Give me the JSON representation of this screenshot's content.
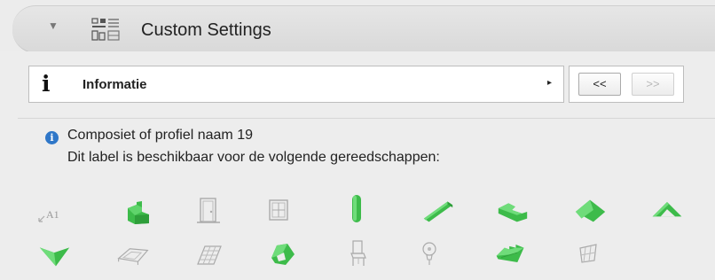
{
  "header": {
    "title": "Custom Settings",
    "icon": "custom-settings-icon",
    "disclosure": "▼"
  },
  "info_bar": {
    "icon_glyph": "i",
    "label": "Informatie",
    "arrow": "▸"
  },
  "nav": {
    "prev_label": "<<",
    "next_label": ">>"
  },
  "description": {
    "line1": "Composiet of profiel naam 19",
    "line2": "Dit label is beschikbaar voor de volgende gereedschappen:"
  },
  "tools": {
    "row1": [
      {
        "name": "label-tool",
        "text": "A1",
        "enabled": false
      },
      {
        "name": "wall-tool",
        "enabled": true
      },
      {
        "name": "door-tool",
        "enabled": false
      },
      {
        "name": "window-tool",
        "enabled": false
      },
      {
        "name": "column-tool",
        "enabled": true
      },
      {
        "name": "beam-tool",
        "enabled": true
      },
      {
        "name": "slab-tool",
        "enabled": true
      },
      {
        "name": "roof-tool",
        "enabled": true
      },
      {
        "name": "shell-tool",
        "enabled": true
      }
    ],
    "row2": [
      {
        "name": "skylight-tool",
        "enabled": true
      },
      {
        "name": "mesh-tool",
        "enabled": false
      },
      {
        "name": "curtain-wall-tool",
        "enabled": false
      },
      {
        "name": "morph-tool",
        "enabled": true
      },
      {
        "name": "object-tool",
        "enabled": false
      },
      {
        "name": "lamp-tool",
        "enabled": false
      },
      {
        "name": "stair-tool",
        "enabled": true
      },
      {
        "name": "railing-tool",
        "enabled": false
      }
    ]
  },
  "colors": {
    "enabled_green": "#3dbb4a",
    "disabled_gray": "#b5b5b5",
    "info_blue": "#2f77c8"
  }
}
